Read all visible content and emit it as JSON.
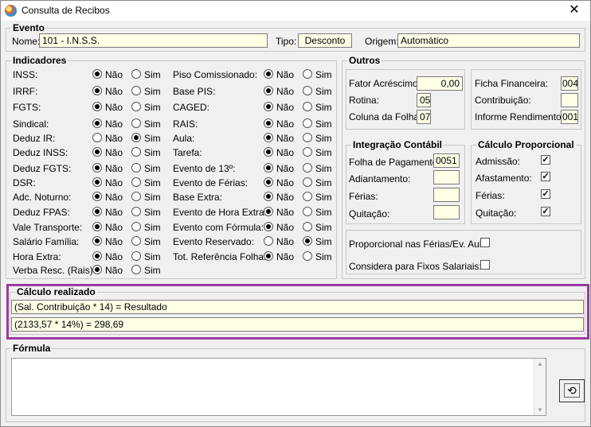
{
  "window": {
    "title": "Consulta de Recibos"
  },
  "evento": {
    "legend": "Evento",
    "nome_label": "Nome:",
    "nome_value": "101 - I.N.S.S.",
    "tipo_label": "Tipo:",
    "tipo_value": "Desconto",
    "origem_label": "Origem:",
    "origem_value": "Automático"
  },
  "indicadores": {
    "legend": "Indicadores",
    "nao": "Não",
    "sim": "Sim",
    "left": [
      {
        "label": "INSS:",
        "checked": "nao"
      },
      {
        "label": "IRRF:",
        "checked": "nao"
      },
      {
        "label": "FGTS:",
        "checked": "nao"
      },
      {
        "label": "Sindical:",
        "checked": "nao"
      },
      {
        "label": "Deduz IR:",
        "checked": "sim"
      },
      {
        "label": "Deduz INSS:",
        "checked": "nao"
      },
      {
        "label": "Deduz FGTS:",
        "checked": "nao"
      },
      {
        "label": "DSR:",
        "checked": "nao"
      },
      {
        "label": "Adc. Noturno:",
        "checked": "nao"
      },
      {
        "label": "Deduz FPAS:",
        "checked": "nao"
      },
      {
        "label": "Vale Transporte:",
        "checked": "nao"
      },
      {
        "label": "Salário Família:",
        "checked": "nao"
      },
      {
        "label": "Hora Extra:",
        "checked": "nao"
      },
      {
        "label": "Verba Resc. (Rais):",
        "checked": "nao"
      }
    ],
    "right": [
      {
        "label": "Piso Comissionado:",
        "checked": "nao"
      },
      {
        "label": "Base PIS:",
        "checked": "nao"
      },
      {
        "label": "CAGED:",
        "checked": "nao"
      },
      {
        "label": "RAIS:",
        "checked": "nao"
      },
      {
        "label": "Aula:",
        "checked": "nao"
      },
      {
        "label": "Tarefa:",
        "checked": "nao"
      },
      {
        "label": "Evento de 13º:",
        "checked": "nao"
      },
      {
        "label": "Evento de Férias:",
        "checked": "nao"
      },
      {
        "label": "Base Extra:",
        "checked": "nao"
      },
      {
        "label": "Evento de Hora Extra:",
        "checked": "nao"
      },
      {
        "label": "Evento com Fórmula:",
        "checked": "nao"
      },
      {
        "label": "Evento Reservado:",
        "checked": "sim"
      },
      {
        "label": "Tot. Referência Folha:",
        "checked": "nao"
      }
    ]
  },
  "outros": {
    "legend": "Outros",
    "fator_label": "Fator Acréscimo:",
    "fator_value": "0,00",
    "rotina_label": "Rotina:",
    "rotina_value": "05",
    "coluna_label": "Coluna da Folha:",
    "coluna_value": "07",
    "ficha_label": "Ficha Financeira:",
    "ficha_value": "004",
    "contribuicao_label": "Contribuição:",
    "contribuicao_value": "",
    "informe_label": "Informe Rendimentos:",
    "informe_value": "001"
  },
  "integracao": {
    "legend": "Integração Contábil",
    "folha_label": "Folha de Pagamento:",
    "folha_value": "0051",
    "adiantamento_label": "Adiantamento:",
    "adiantamento_value": "",
    "ferias_label": "Férias:",
    "ferias_value": "",
    "quitacao_label": "Quitação:",
    "quitacao_value": ""
  },
  "proporcional": {
    "legend": "Cálculo Proporcional",
    "admissao_label": "Admissão:",
    "afastamento_label": "Afastamento:",
    "ferias_label": "Férias:",
    "quitacao_label": "Quitação:",
    "check_mark": "✓"
  },
  "extras": {
    "prop_ferias_label": "Proporcional nas Férias/Ev. Aula:",
    "fixos_label": "Considera para Fixos Salariais:"
  },
  "calculo": {
    "legend": "Cálculo realizado",
    "formula_line": "(Sal. Contribuição * 14) = Resultado",
    "result_line": "(2133,57 * 14%) = 298,69"
  },
  "formula": {
    "legend": "Fórmula",
    "value": ""
  },
  "icons": {
    "close": "✕",
    "undo": "⟲",
    "scroll_up": "▲",
    "scroll_down": "▼"
  },
  "colors": {
    "field_bg": "#ffffe6",
    "highlight": "#9b3aa0"
  }
}
